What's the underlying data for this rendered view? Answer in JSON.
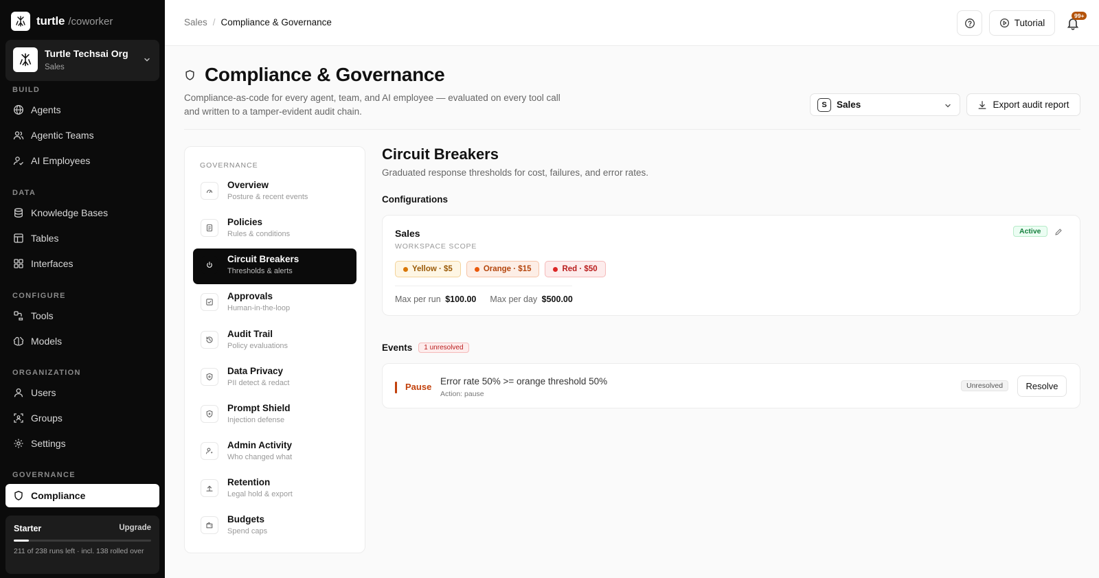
{
  "app": {
    "brand": "turtle",
    "brand_suffix": "/coworker"
  },
  "org": {
    "name": "Turtle Techsai Org",
    "workspace": "Sales"
  },
  "sidebar": {
    "sections": {
      "build": "BUILD",
      "data": "DATA",
      "configure": "CONFIGURE",
      "organization": "ORGANIZATION",
      "governance": "GOVERNANCE"
    },
    "items": {
      "agents": "Agents",
      "agentic_teams": "Agentic Teams",
      "ai_employees": "AI Employees",
      "knowledge_bases": "Knowledge Bases",
      "tables": "Tables",
      "interfaces": "Interfaces",
      "tools": "Tools",
      "models": "Models",
      "users": "Users",
      "groups": "Groups",
      "settings": "Settings",
      "compliance": "Compliance"
    },
    "plan": {
      "name": "Starter",
      "upgrade": "Upgrade",
      "usage_fraction": 0.11,
      "usage_text": "211 of 238 runs left · incl. 138 rolled over"
    }
  },
  "topbar": {
    "breadcrumb_root": "Sales",
    "breadcrumb_sep": "/",
    "breadcrumb_current": "Compliance & Governance",
    "tutorial": "Tutorial",
    "notifications": "99+"
  },
  "page": {
    "title": "Compliance & Governance",
    "description": "Compliance-as-code for every agent, team, and AI employee — evaluated on every tool call and written to a tamper-evident audit chain.",
    "workspace_badge": "S",
    "workspace_select": "Sales",
    "export": "Export audit report"
  },
  "governance_menu": {
    "label": "GOVERNANCE",
    "items": [
      {
        "title": "Overview",
        "subtitle": "Posture & recent events"
      },
      {
        "title": "Policies",
        "subtitle": "Rules & conditions"
      },
      {
        "title": "Circuit Breakers",
        "subtitle": "Thresholds & alerts"
      },
      {
        "title": "Approvals",
        "subtitle": "Human-in-the-loop"
      },
      {
        "title": "Audit Trail",
        "subtitle": "Policy evaluations"
      },
      {
        "title": "Data Privacy",
        "subtitle": "PII detect & redact"
      },
      {
        "title": "Prompt Shield",
        "subtitle": "Injection defense"
      },
      {
        "title": "Admin Activity",
        "subtitle": "Who changed what"
      },
      {
        "title": "Retention",
        "subtitle": "Legal hold & export"
      },
      {
        "title": "Budgets",
        "subtitle": "Spend caps"
      }
    ]
  },
  "circuit_breakers": {
    "title": "Circuit Breakers",
    "description": "Graduated response thresholds for cost, failures, and error rates.",
    "configurations_label": "Configurations",
    "config": {
      "name": "Sales",
      "scope": "WORKSPACE SCOPE",
      "status": "Active",
      "thresholds": {
        "yellow": "Yellow · $5",
        "orange": "Orange · $15",
        "red": "Red · $50"
      },
      "max_run_label": "Max per run",
      "max_run_value": "$100.00",
      "max_day_label": "Max per day",
      "max_day_value": "$500.00"
    },
    "events_label": "Events",
    "events_badge": "1 unresolved",
    "event": {
      "type": "Pause",
      "message": "Error rate 50% >= orange threshold 50%",
      "action": "Action: pause",
      "status": "Unresolved",
      "resolve": "Resolve"
    }
  },
  "colors": {
    "sidebar_bg": "#0b0b0b",
    "accent_active": "#15803d",
    "pause": "#c2410c",
    "badge": "#b45309"
  }
}
